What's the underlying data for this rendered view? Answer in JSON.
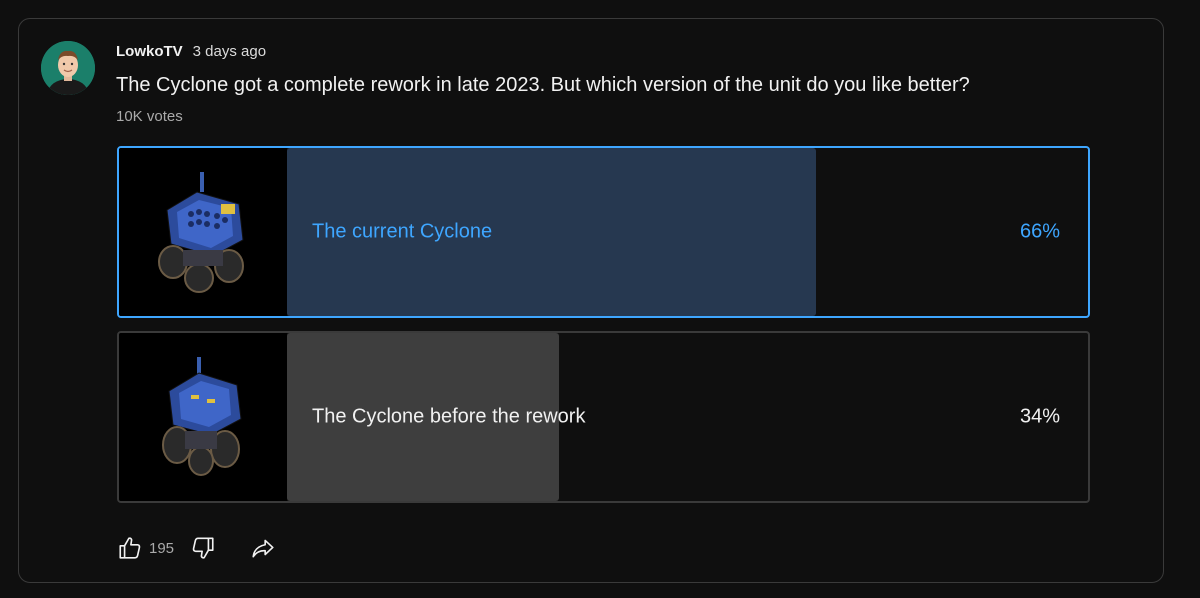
{
  "post": {
    "author": "LowkoTV",
    "time": "3 days ago",
    "question": "The Cyclone got a complete rework in late 2023. But which version of the unit do you like better?",
    "votes": "10K votes"
  },
  "options": [
    {
      "label": "The current Cyclone",
      "percent_text": "66%",
      "percent": 66,
      "selected": true
    },
    {
      "label": "The Cyclone before the rework",
      "percent_text": "34%",
      "percent": 34,
      "selected": false
    }
  ],
  "actions": {
    "like_count": "195",
    "icons": [
      "thumbs-up-icon",
      "thumbs-down-icon",
      "share-icon"
    ]
  },
  "colors": {
    "background": "#0f0f0f",
    "accent": "#3ea6ff",
    "selected_bar": "#263850",
    "unselected_bar": "#3e3e3e",
    "border": "#3a3a3a",
    "avatar_bg": "#1b7f6a"
  }
}
